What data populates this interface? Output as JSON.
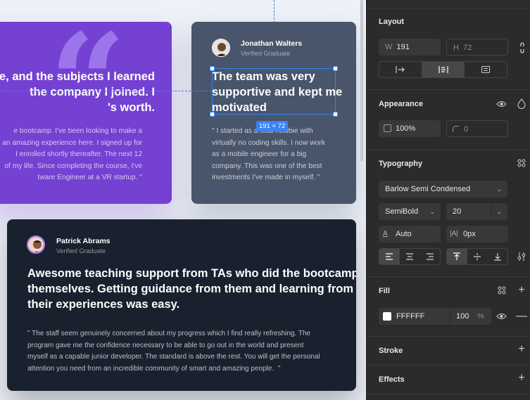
{
  "canvas": {
    "cards": [
      {
        "heading": "se, and the subjects I learned\n the company I joined. I\n's worth.",
        "body": "e bootcamp. I've been looking to make a\nan amazing experience here. I signed up for\nI enrolled shortly thereafter. The next 12\nof my life. Since completing the course, I've\ntware Engineer at a VR startup. \""
      },
      {
        "name": "Jonathan Walters",
        "role": "Verified Graduate",
        "heading": "The team was very\nsupportive and kept me\nmotivated",
        "body": "\" I started as a total newbie with\nvirtually no coding skills. I now work\nas a mobile engineer for a big\ncompany. This was one of the best\ninvestments I've made in myself. \""
      },
      {
        "name": "Patrick Abrams",
        "role": "Verified Graduate",
        "heading": "Awesome teaching support from TAs who did the bootcamp\nthemselves. Getting guidance from them and learning from\ntheir experiences was easy.",
        "body": "\" The staff seem genuinely concerned about my progress which I find really refreshing. The\nprogram gave me the confidence necessary to be able to go out in the world and present\nmyself as a capable junior developer. The standard is above the rest. You will get the personal\nattention you need from an incredible community of smart and amazing people.  \""
      }
    ],
    "selection": {
      "size_label": "191 × 72"
    },
    "colors": {
      "purple_card": "#7541d2",
      "slate_card": "#48556a",
      "dark_card": "#19212e",
      "selection": "#3b82f6"
    }
  },
  "panel": {
    "layout": {
      "title": "Layout",
      "w_label": "W",
      "w_value": "191",
      "h_label": "H",
      "h_value": "72"
    },
    "appearance": {
      "title": "Appearance",
      "opacity": "100%",
      "radius": "0"
    },
    "typography": {
      "title": "Typography",
      "font_family": "Barlow Semi Condensed",
      "font_weight": "SemiBold",
      "font_size": "20",
      "line_height": "Auto",
      "letter_spacing": "0px"
    },
    "fill": {
      "title": "Fill",
      "hex": "FFFFFF",
      "opacity": "100",
      "unit": "%"
    },
    "stroke": {
      "title": "Stroke"
    },
    "effects": {
      "title": "Effects"
    }
  }
}
